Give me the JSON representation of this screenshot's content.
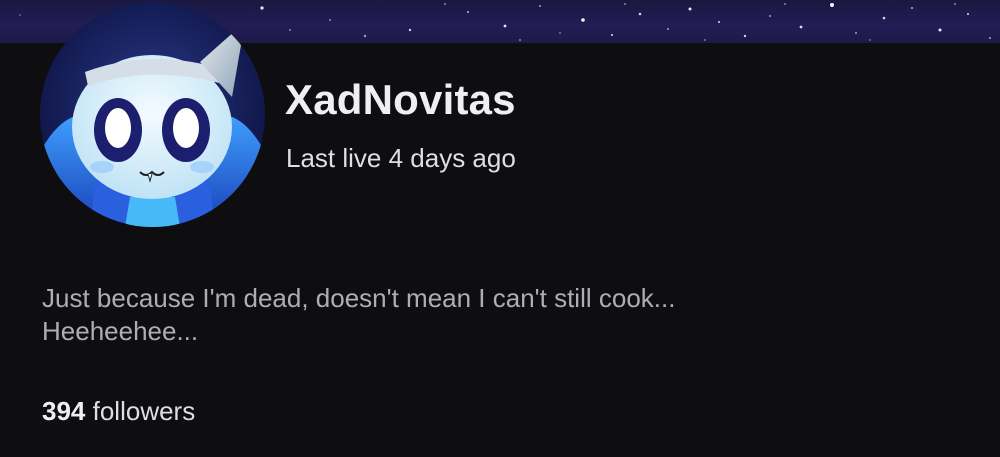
{
  "channel": {
    "username": "XadNovitas",
    "last_live": "Last live 4 days ago",
    "bio_line1": "Just because I'm dead, doesn't mean I can't still cook...",
    "bio_line2": "Heeheehee...",
    "followers_count": "394",
    "followers_label": "followers"
  },
  "icons": {
    "avatar": "ghost-avatar-image",
    "banner": "starry-sky-banner"
  },
  "colors": {
    "background": "#0e0e10",
    "banner": "#221d55",
    "primary_text": "#efeff1",
    "secondary_text": "#adadb8"
  }
}
